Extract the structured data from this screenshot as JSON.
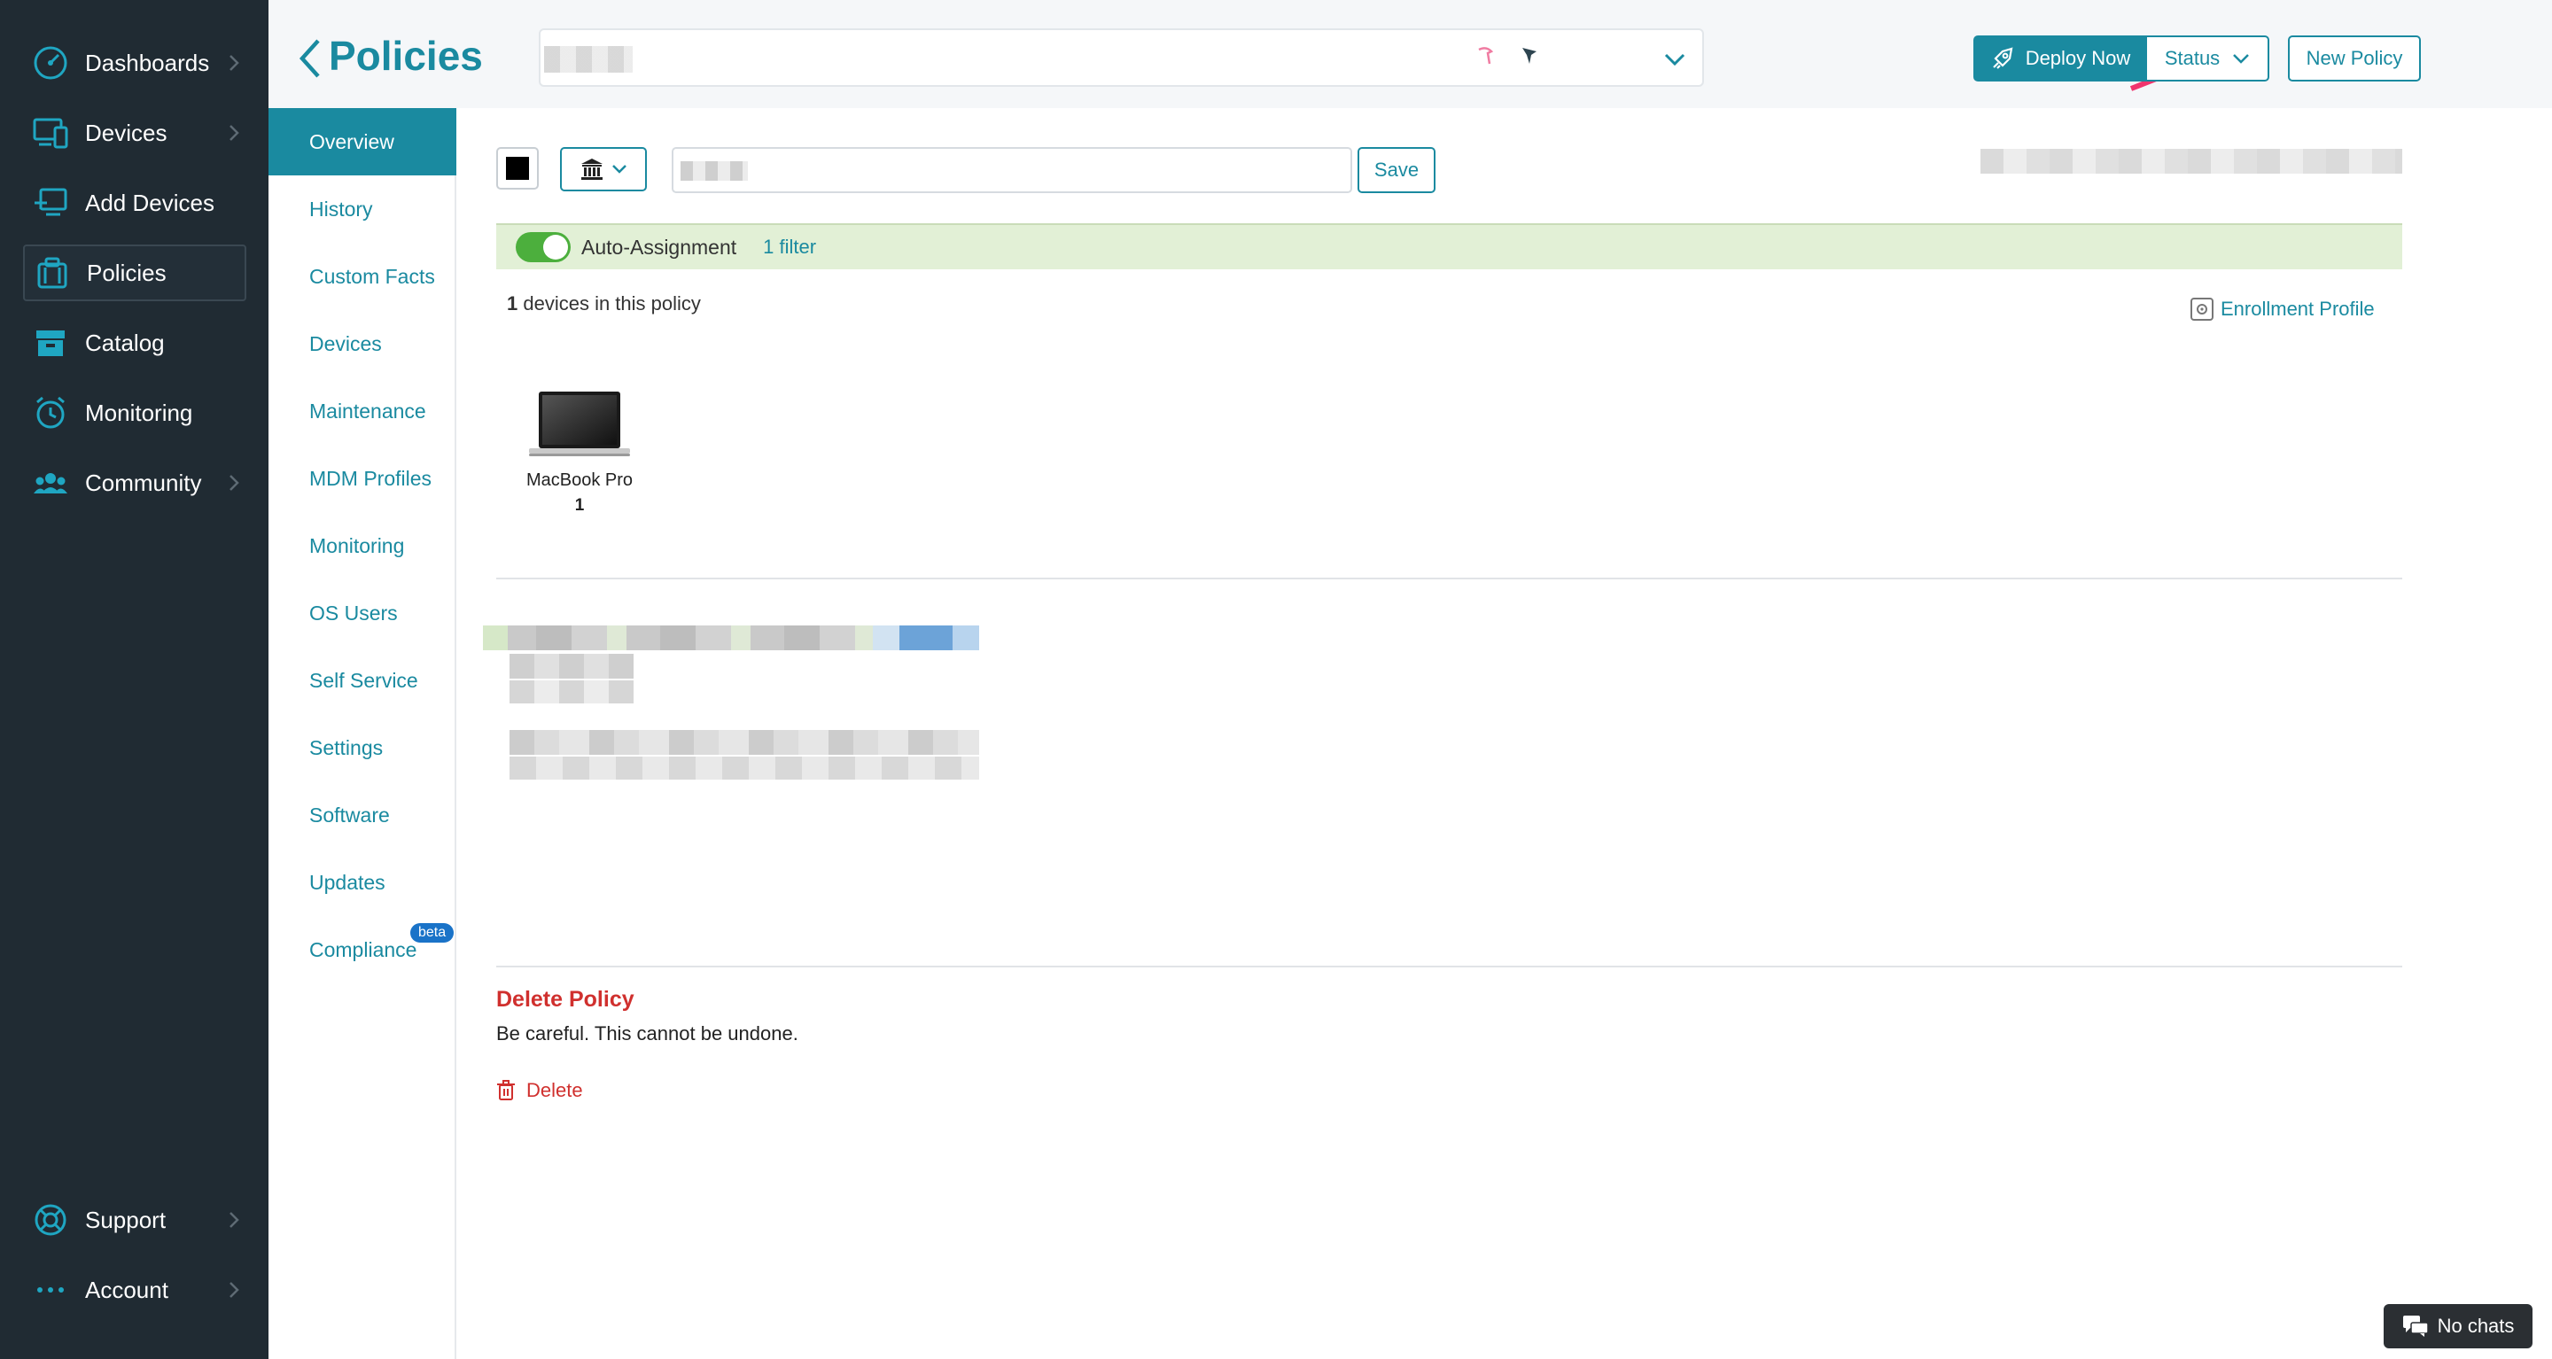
{
  "sidebar": {
    "items": [
      {
        "label": "Dashboards",
        "icon": "dashboard-icon",
        "chevron": true
      },
      {
        "label": "Devices",
        "icon": "devices-icon",
        "chevron": true
      },
      {
        "label": "Add Devices",
        "icon": "add-device-icon",
        "chevron": false
      },
      {
        "label": "Policies",
        "icon": "policies-icon",
        "chevron": false,
        "active": true
      },
      {
        "label": "Catalog",
        "icon": "catalog-icon",
        "chevron": false
      },
      {
        "label": "Monitoring",
        "icon": "alarm-clock-icon",
        "chevron": false
      },
      {
        "label": "Community",
        "icon": "community-icon",
        "chevron": true
      }
    ],
    "bottom_items": [
      {
        "label": "Support",
        "icon": "lifebuoy-icon",
        "chevron": true
      },
      {
        "label": "Account",
        "icon": "more-dots-icon",
        "chevron": true
      }
    ]
  },
  "header": {
    "title": "Policies",
    "deploy_label": "Deploy Now",
    "status_label": "Status",
    "new_policy_label": "New Policy"
  },
  "submenu": {
    "items": [
      "Overview",
      "History",
      "Custom Facts",
      "Devices",
      "Maintenance",
      "MDM Profiles",
      "Monitoring",
      "OS Users",
      "Self Service",
      "Settings",
      "Software",
      "Updates",
      "Compliance"
    ],
    "active": "Overview",
    "beta_badge": "beta"
  },
  "main": {
    "save_label": "Save",
    "auto_assignment_label": "Auto-Assignment",
    "filter_link": "1 filter",
    "devices_count": "1",
    "devices_count_suffix": " devices in this policy",
    "enrollment_profile": "Enrollment Profile",
    "device_card": {
      "model": "MacBook Pro",
      "count": "1"
    },
    "delete": {
      "title": "Delete Policy",
      "description": "Be careful. This cannot be undone.",
      "button": "Delete"
    }
  },
  "chat": {
    "label": "No chats"
  },
  "colors": {
    "accent": "#1a8aa0",
    "sidebar_bg": "#202b33",
    "danger": "#d0302e",
    "toggle_on": "#4caf3d",
    "annotation_arrow": "#f0356e"
  }
}
